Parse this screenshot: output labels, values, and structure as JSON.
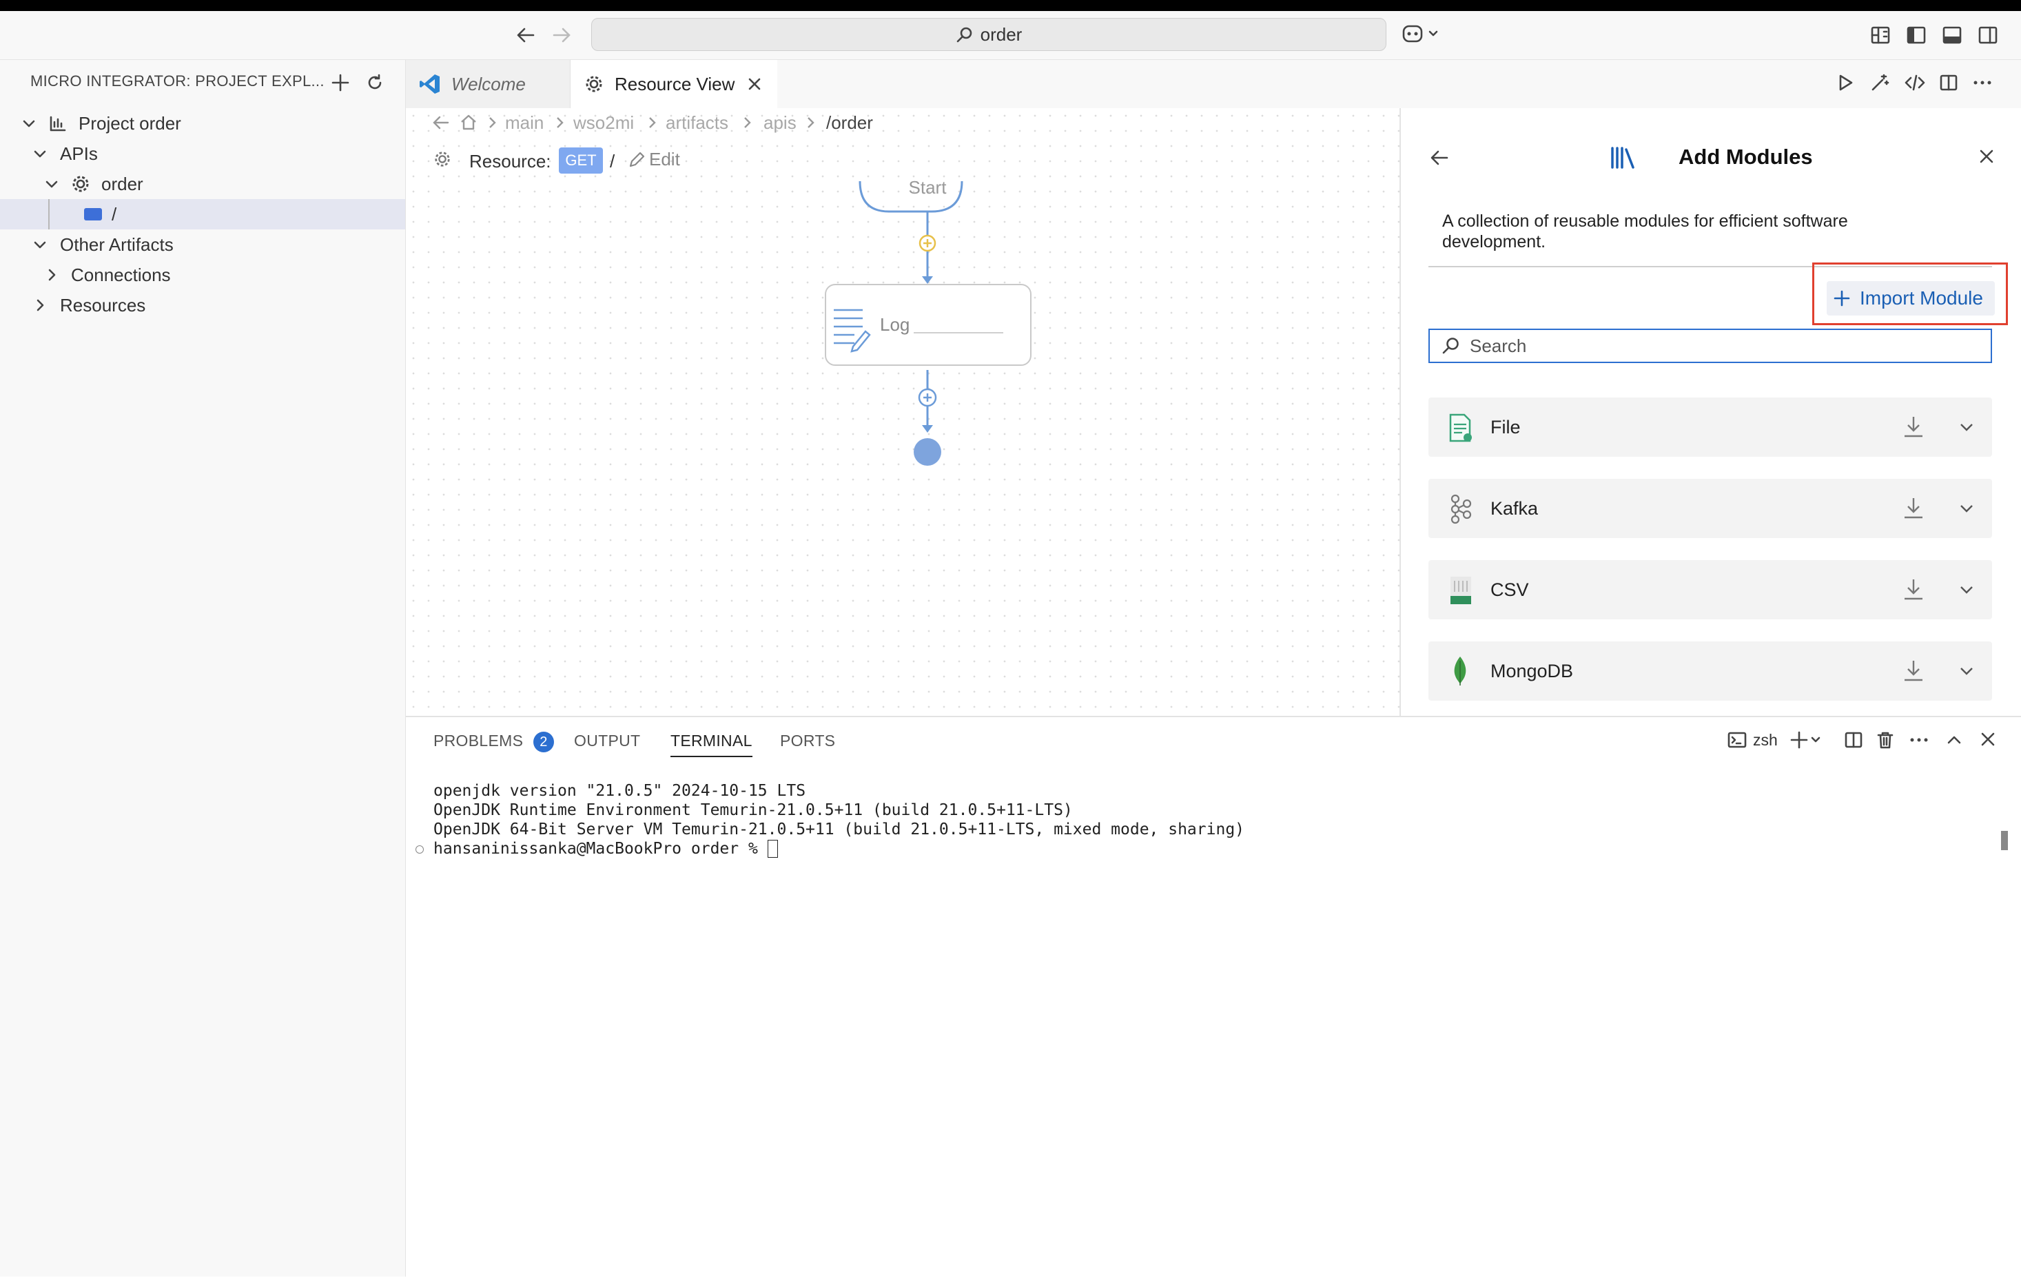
{
  "titlebar": {
    "search_value": "order"
  },
  "sidebar": {
    "title": "MICRO INTEGRATOR: PROJECT EXPL...",
    "items": [
      {
        "label": "Project order"
      },
      {
        "label": "APIs"
      },
      {
        "label": "order"
      },
      {
        "label": "/"
      },
      {
        "label": "Other Artifacts"
      },
      {
        "label": "Connections"
      },
      {
        "label": "Resources"
      }
    ]
  },
  "tabs": [
    {
      "label": "Welcome"
    },
    {
      "label": "Resource View"
    }
  ],
  "breadcrumb": [
    "main",
    "wso2mi",
    "artifacts",
    "apis",
    "/order"
  ],
  "resource": {
    "label": "Resource:",
    "method": "GET",
    "path": "/",
    "edit": "Edit"
  },
  "canvas": {
    "start_label": "Start",
    "log_label": "Log"
  },
  "panel": {
    "title": "Add Modules",
    "description": "A collection of reusable modules for efficient software development.",
    "import_button": "Import Module",
    "search_placeholder": "Search",
    "modules": [
      {
        "name": "File"
      },
      {
        "name": "Kafka"
      },
      {
        "name": "CSV"
      },
      {
        "name": "MongoDB"
      }
    ]
  },
  "bottom": {
    "tabs": [
      "PROBLEMS",
      "OUTPUT",
      "TERMINAL",
      "PORTS"
    ],
    "problems_count": "2",
    "shell": "zsh",
    "terminal_lines": [
      "openjdk version \"21.0.5\" 2024-10-15 LTS",
      "OpenJDK Runtime Environment Temurin-21.0.5+11 (build 21.0.5+11-LTS)",
      "OpenJDK 64-Bit Server VM Temurin-21.0.5+11 (build 21.0.5+11-LTS, mixed mode, sharing)",
      "hansaninissanka@MacBookPro order % "
    ]
  },
  "colors": {
    "accent": "#1a5fb4",
    "highlight_box": "#e0402f",
    "method_badge": "#7fa8f0",
    "flow": "#6b9bd8"
  }
}
